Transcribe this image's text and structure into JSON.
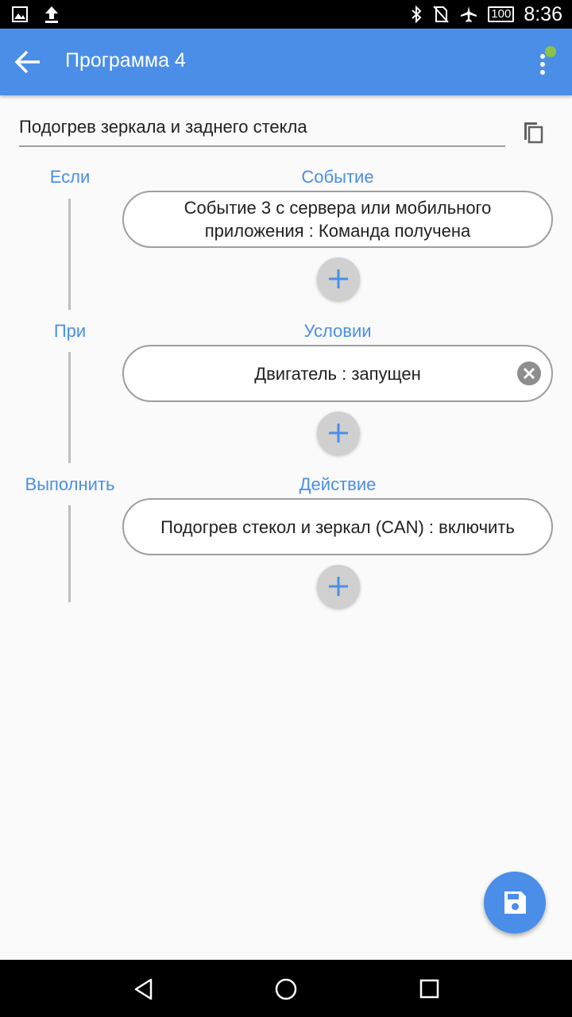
{
  "status_bar": {
    "time": "8:36",
    "battery": "100",
    "icons": [
      "image-icon",
      "upload-icon",
      "bluetooth-icon",
      "no-sim-icon",
      "airplane-icon",
      "battery-icon"
    ]
  },
  "app_bar": {
    "title": "Программа 4",
    "menu_indicator_color": "#8bc34a"
  },
  "program": {
    "name": "Подогрев зеркала и заднего стекла"
  },
  "sections": {
    "event": {
      "label": "Если",
      "header": "Событие",
      "items": [
        "Событие  3 с сервера или мобильного приложения : Команда получена"
      ]
    },
    "condition": {
      "label": "При",
      "header": "Условии",
      "items": [
        "Двигатель : запущен"
      ]
    },
    "action": {
      "label": "Выполнить",
      "header": "Действие",
      "items": [
        "Подогрев стекол и зеркал (CAN) : включить"
      ]
    }
  },
  "colors": {
    "accent": "#4a8ee8",
    "pill_border": "#9e9e9e",
    "add_button_bg": "#d0d0d0",
    "background": "#fafafa"
  }
}
